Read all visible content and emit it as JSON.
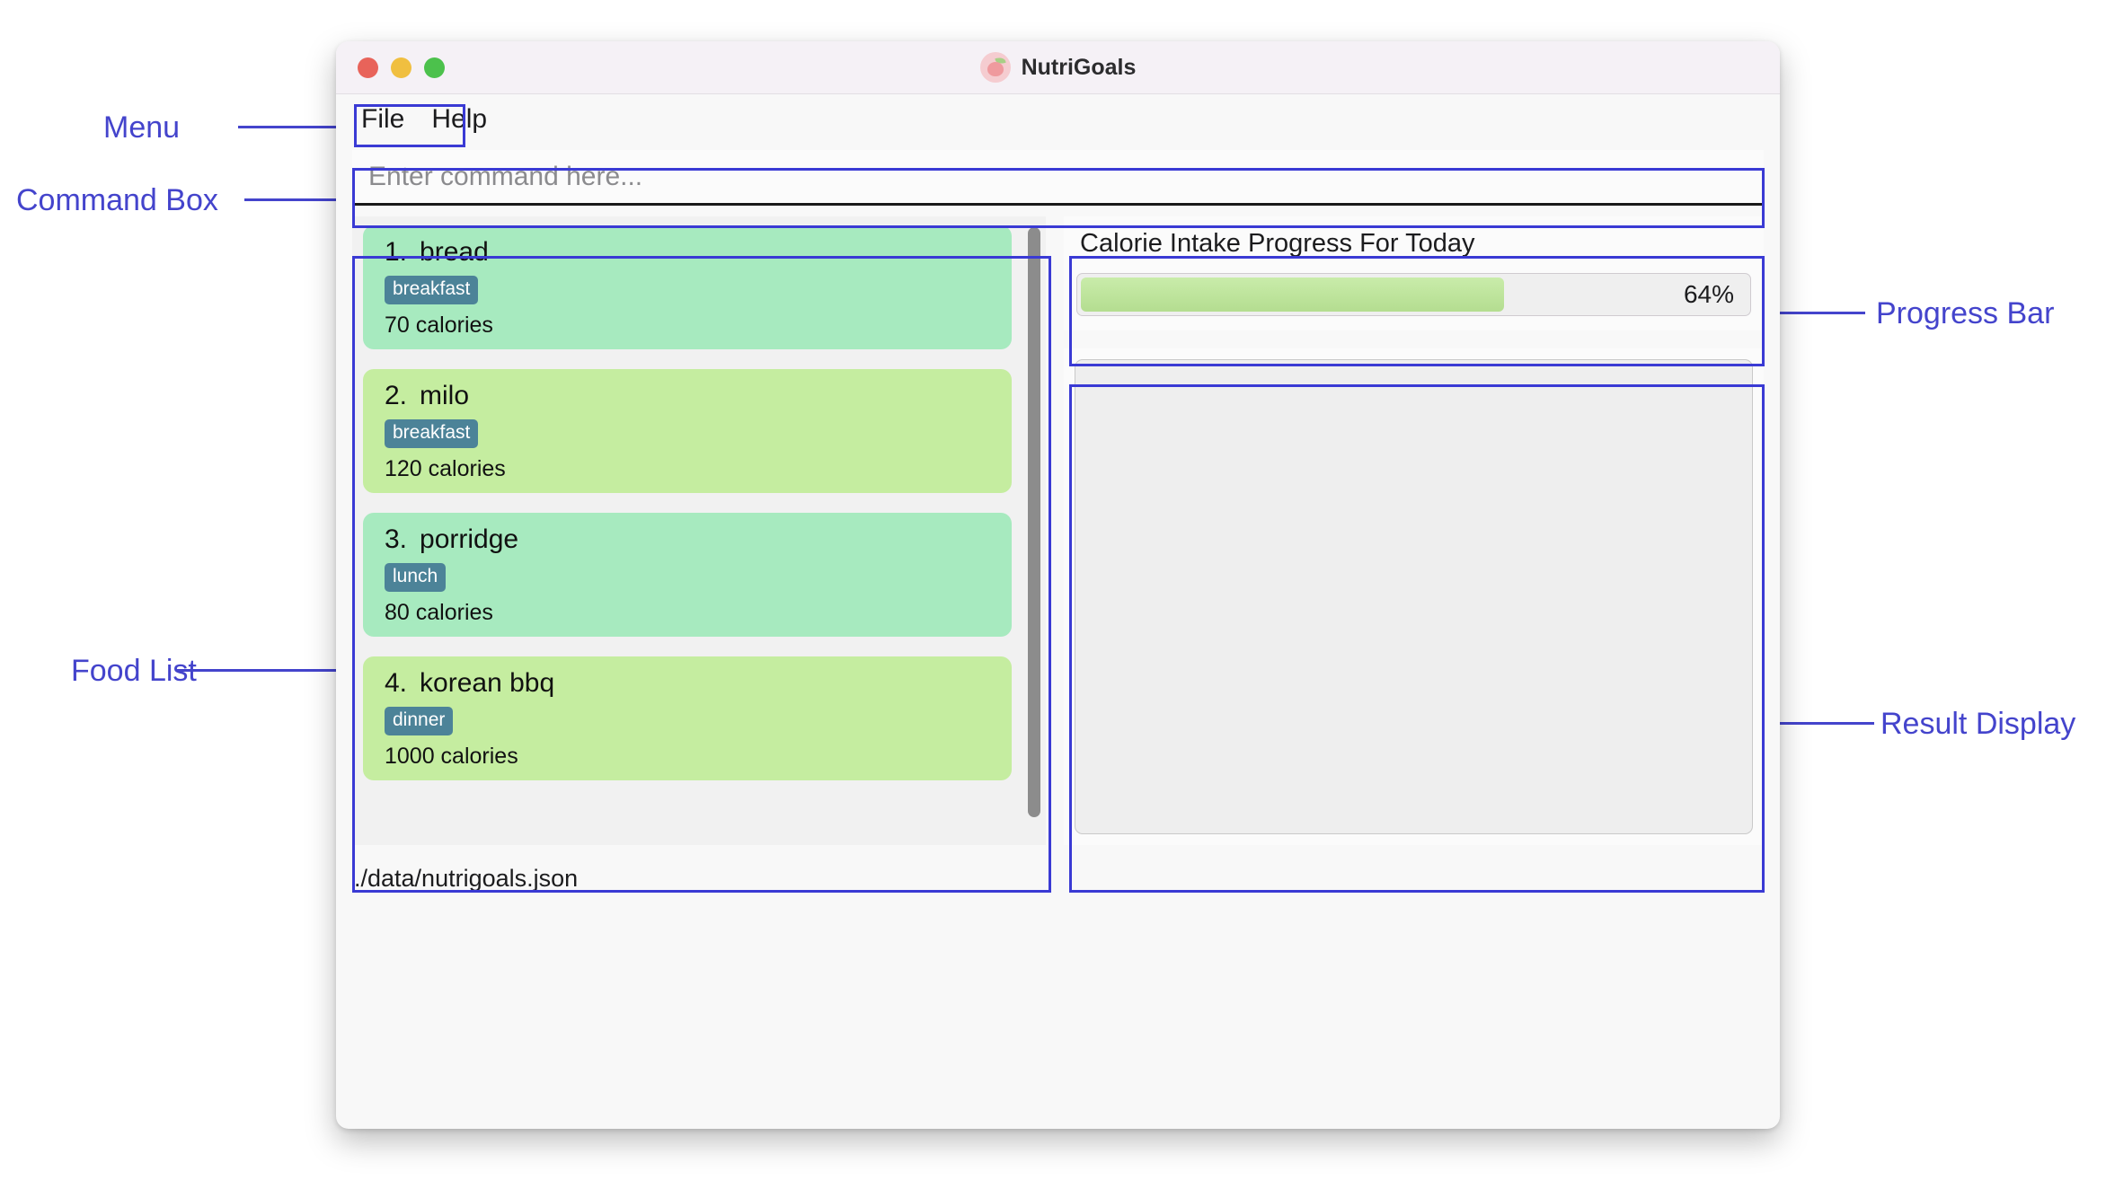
{
  "window": {
    "title": "NutriGoals",
    "icon": "apple-icon",
    "traffic_lights": [
      {
        "name": "close",
        "color": "#e8635a"
      },
      {
        "name": "minimize",
        "color": "#f0bf40"
      },
      {
        "name": "maximize",
        "color": "#4cc14c"
      }
    ]
  },
  "menu": {
    "items": [
      {
        "label": "File"
      },
      {
        "label": "Help"
      }
    ]
  },
  "command_box": {
    "value": "",
    "placeholder": "Enter command here..."
  },
  "food_list": {
    "items": [
      {
        "index": "1.",
        "name": "bread",
        "tag": "breakfast",
        "calories": "70 calories",
        "color": "#a7eabf"
      },
      {
        "index": "2.",
        "name": "milo",
        "tag": "breakfast",
        "calories": "120 calories",
        "color": "#c5eda0"
      },
      {
        "index": "3.",
        "name": "porridge",
        "tag": "lunch",
        "calories": "80 calories",
        "color": "#a7eabf"
      },
      {
        "index": "4.",
        "name": "korean bbq",
        "tag": "dinner",
        "calories": "1000 calories",
        "color": "#c5eda0"
      }
    ]
  },
  "progress": {
    "title": "Calorie Intake Progress For Today",
    "percent_label": "64%",
    "percent_value": 64,
    "fill_color": "#b4dd90"
  },
  "result_display": {
    "content": ""
  },
  "footer": {
    "file_path": "./data/nutrigoals.json"
  },
  "annotations": {
    "accent_color": "#4444cc",
    "labels": [
      {
        "id": "menu",
        "text": "Menu"
      },
      {
        "id": "command-box",
        "text": "Command Box"
      },
      {
        "id": "food-list",
        "text": "Food List"
      },
      {
        "id": "progress-bar",
        "text": "Progress Bar"
      },
      {
        "id": "result",
        "text": "Result Display"
      }
    ]
  }
}
